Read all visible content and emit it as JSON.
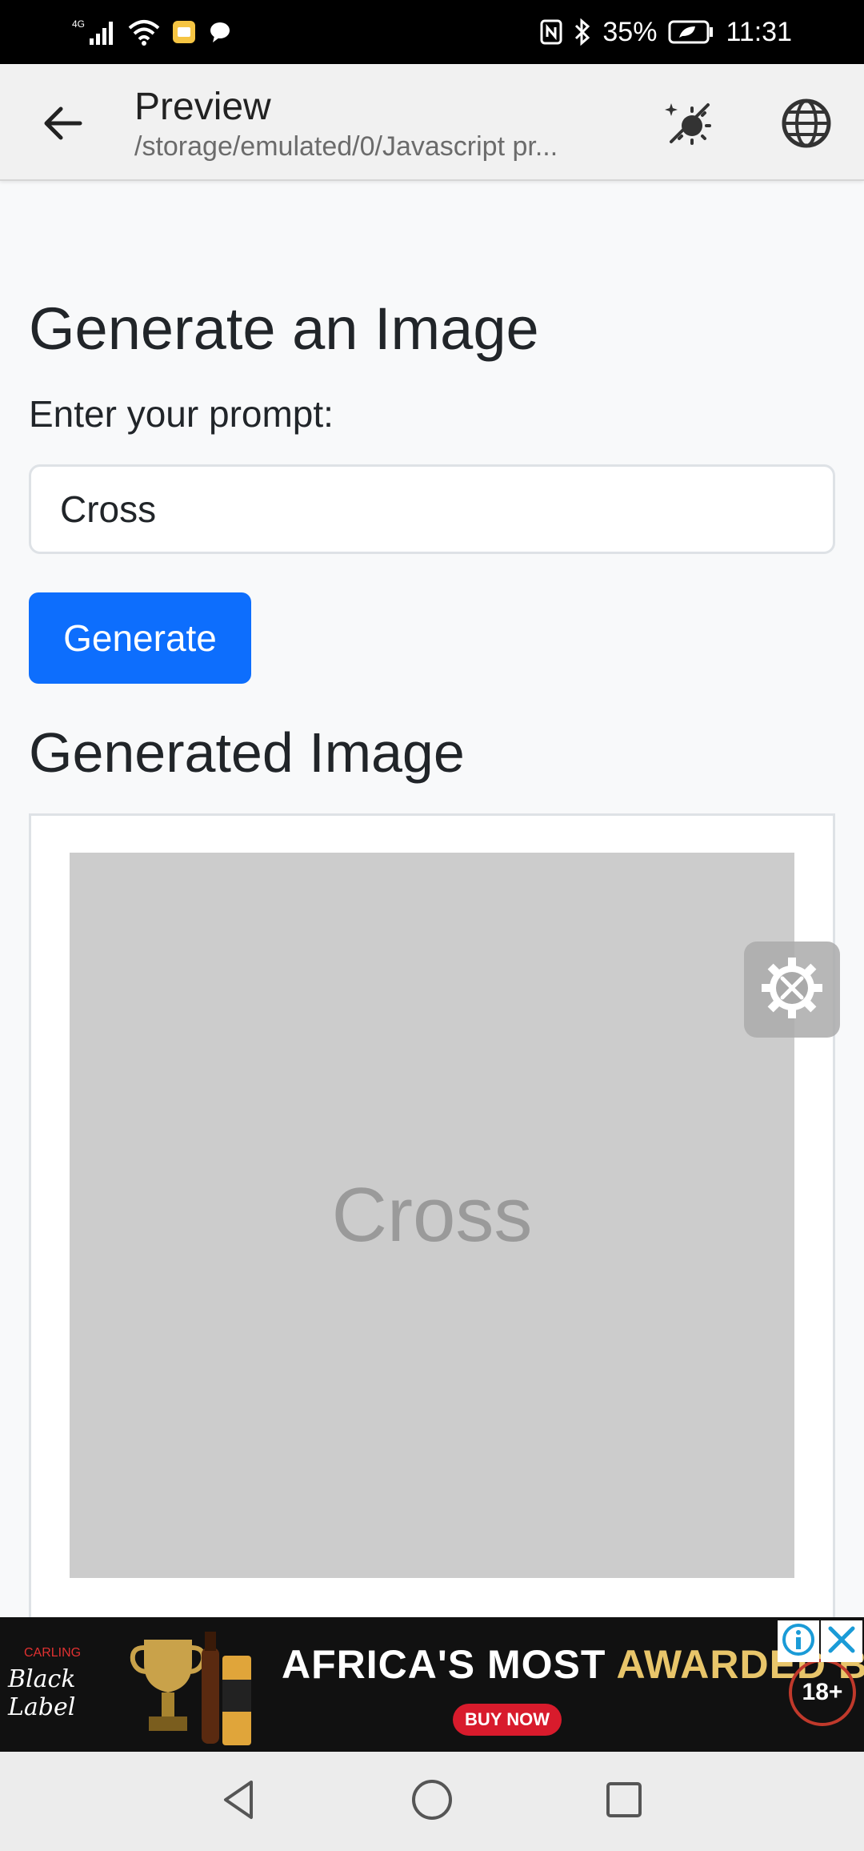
{
  "status_bar": {
    "network": "4G",
    "battery": "35%",
    "time": "11:31"
  },
  "app_bar": {
    "title": "Preview",
    "subtitle": "/storage/emulated/0/Javascript pr..."
  },
  "page": {
    "heading": "Generate an Image",
    "prompt_label": "Enter your prompt:",
    "prompt_value": "Cross",
    "generate_button": "Generate",
    "result_heading": "Generated Image",
    "placeholder_text": "Cross"
  },
  "ad": {
    "brand": "Black Label",
    "brand_small": "CARLING",
    "headline_white": "AFRICA'S MOST ",
    "headline_gold": "AWARDED BEER",
    "cta": "BUY NOW",
    "age_badge": "18+"
  },
  "icons": {
    "back": "arrow-left-icon",
    "theme": "theme-toggle-icon",
    "globe": "globe-icon",
    "tools": "gear-wrench-icon",
    "info": "info-icon",
    "close": "close-icon"
  },
  "colors": {
    "primary": "#0d6efd",
    "placeholder_bg": "#cccccc",
    "page_bg": "#f8f9fa"
  }
}
